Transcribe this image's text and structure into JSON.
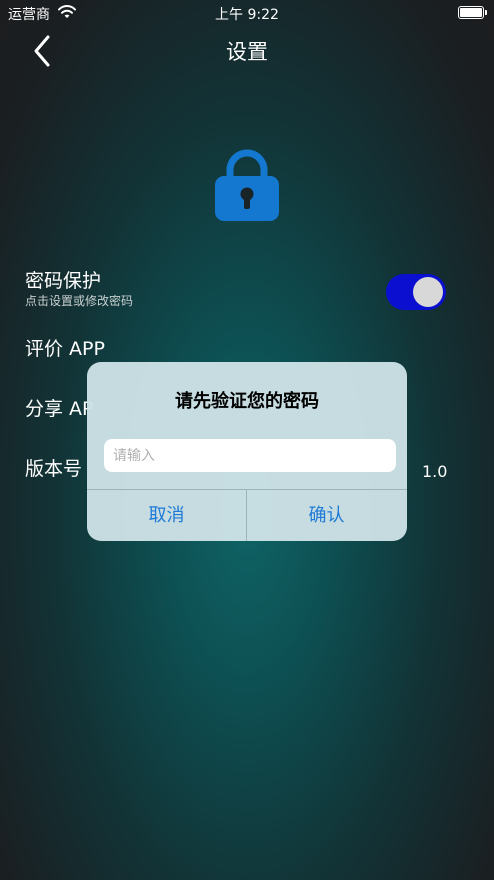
{
  "status_bar": {
    "carrier": "运营商",
    "time": "上午 9:22"
  },
  "nav": {
    "title": "设置"
  },
  "settings": {
    "password_protect": {
      "label": "密码保护",
      "sub": "点击设置或修改密码",
      "enabled": true
    },
    "rate_label": "评价 APP",
    "share_label": "分享 AP",
    "version_label": "版本号",
    "version_value": "1.0"
  },
  "dialog": {
    "title": "请先验证您的密码",
    "placeholder": "请输入",
    "value": "",
    "cancel_label": "取消",
    "confirm_label": "确认"
  },
  "colors": {
    "accent": "#1e7ad6",
    "toggle_on": "#0a0fd0",
    "lock": "#1477d0"
  }
}
